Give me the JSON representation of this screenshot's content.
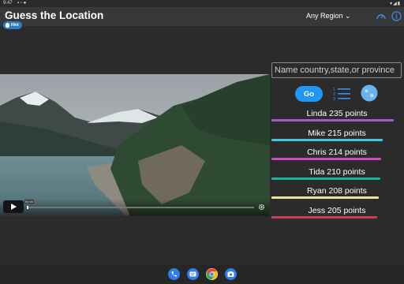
{
  "status_bar": {
    "time": "9:47"
  },
  "app_bar": {
    "title": "Guess the Location",
    "region_label": "Any Region"
  },
  "hint": {
    "label": "Hint"
  },
  "video": {
    "timecode": "00:00"
  },
  "search": {
    "placeholder": "Name country,state,or province",
    "value": ""
  },
  "go_button": {
    "label": "Go"
  },
  "leaderboard": [
    {
      "name": "Linda",
      "label": "Linda 235 points",
      "points": 235,
      "color": "#a25cc6",
      "bar": 0.91
    },
    {
      "name": "Mike",
      "label": "Mike 215 points",
      "points": 215,
      "color": "#3fc9d8",
      "bar": 0.83
    },
    {
      "name": "Chris",
      "label": "Chris 214 points",
      "points": 214,
      "color": "#c94fc0",
      "bar": 0.82
    },
    {
      "name": "Tida",
      "label": "Tida 210 points",
      "points": 210,
      "color": "#16b39c",
      "bar": 0.81
    },
    {
      "name": "Ryan",
      "label": "Ryan 208 points",
      "points": 208,
      "color": "#e8e39a",
      "bar": 0.8
    },
    {
      "name": "Jess",
      "label": "Jess 205 points",
      "points": 205,
      "color": "#c8405a",
      "bar": 0.79
    }
  ],
  "dock": [
    {
      "name": "phone-app",
      "color": "#2f7ee6"
    },
    {
      "name": "messages-app",
      "color": "#2f7ee6"
    },
    {
      "name": "chrome-app",
      "color": "#ffffff"
    },
    {
      "name": "camera-app",
      "color": "#2f7ee6"
    }
  ],
  "colors": {
    "accent": "#2196f3",
    "background": "#2b2b2b",
    "appbar": "#383838"
  }
}
